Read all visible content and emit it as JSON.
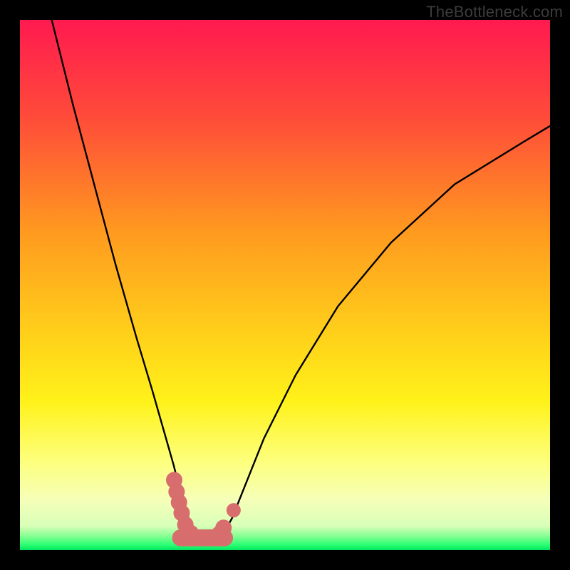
{
  "watermark": "TheBottleneck.com",
  "chart_data": {
    "type": "line",
    "title": "",
    "xlabel": "",
    "ylabel": "",
    "xlim": [
      0,
      100
    ],
    "ylim": [
      0,
      100
    ],
    "gradient_stops": [
      {
        "offset": 0.0,
        "color": "#ff1a4f"
      },
      {
        "offset": 0.18,
        "color": "#ff4a3a"
      },
      {
        "offset": 0.4,
        "color": "#ff9a1f"
      },
      {
        "offset": 0.6,
        "color": "#ffd21a"
      },
      {
        "offset": 0.72,
        "color": "#fff21a"
      },
      {
        "offset": 0.83,
        "color": "#fdff7a"
      },
      {
        "offset": 0.905,
        "color": "#f6ffb8"
      },
      {
        "offset": 0.955,
        "color": "#d8ffb8"
      },
      {
        "offset": 0.975,
        "color": "#7eff8f"
      },
      {
        "offset": 0.99,
        "color": "#2cff74"
      },
      {
        "offset": 1.0,
        "color": "#00e660"
      }
    ],
    "series": [
      {
        "name": "bottleneck-curve",
        "x": [
          6,
          10,
          14,
          18,
          22,
          25,
          27,
          29,
          30.5,
          32,
          33,
          34,
          35,
          36,
          37,
          38.5,
          40,
          42,
          46,
          52,
          60,
          70,
          82,
          95,
          100
        ],
        "y": [
          100,
          84,
          69,
          54,
          40,
          30,
          23,
          16,
          10,
          5.5,
          3.3,
          2.4,
          2.2,
          2.2,
          2.4,
          3.3,
          6,
          11,
          21,
          33,
          46,
          58,
          69,
          77,
          80
        ]
      }
    ],
    "markers": {
      "name": "highlight-band",
      "color": "#d86d6d",
      "capsule": [
        {
          "x1": 30.3,
          "x2": 38.6,
          "y": 2.3,
          "r": 1.6
        }
      ],
      "dots": [
        {
          "x": 29.1,
          "y": 13.2,
          "r": 1.55
        },
        {
          "x": 29.55,
          "y": 11.0,
          "r": 1.55
        },
        {
          "x": 30.0,
          "y": 9.0,
          "r": 1.55
        },
        {
          "x": 30.5,
          "y": 7.0,
          "r": 1.55
        },
        {
          "x": 31.2,
          "y": 4.8,
          "r": 1.55
        },
        {
          "x": 32.2,
          "y": 3.2,
          "r": 1.55
        },
        {
          "x": 37.6,
          "y": 3.0,
          "r": 1.55
        },
        {
          "x": 38.4,
          "y": 4.2,
          "r": 1.55
        },
        {
          "x": 40.3,
          "y": 7.5,
          "r": 1.35
        }
      ]
    }
  }
}
